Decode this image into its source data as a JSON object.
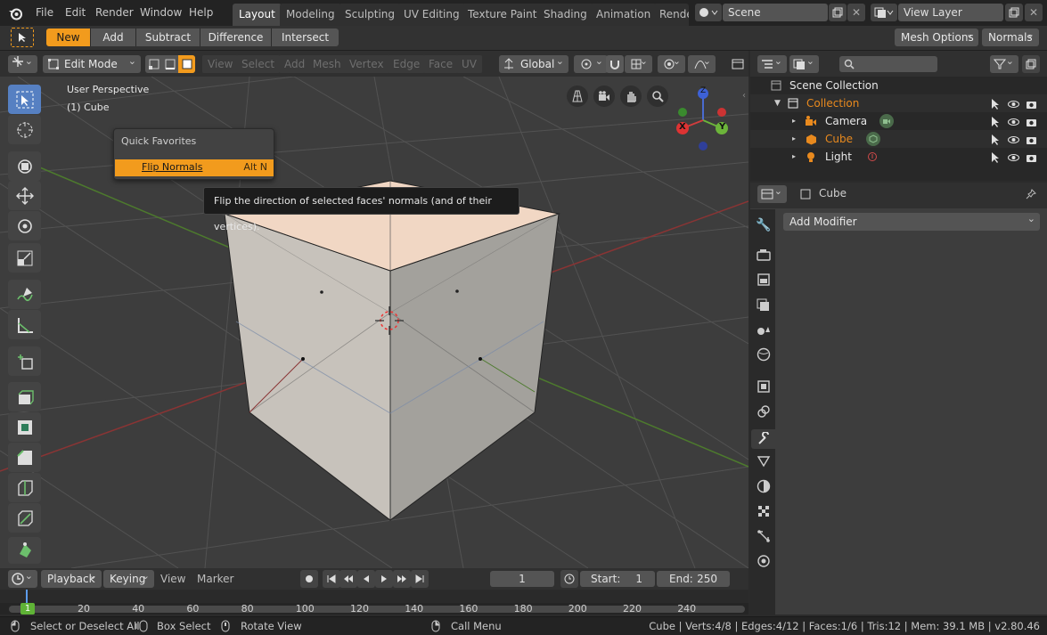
{
  "menu": [
    "File",
    "Edit",
    "Render",
    "Window",
    "Help"
  ],
  "workspaces": [
    "Layout",
    "Modeling",
    "Sculpting",
    "UV Editing",
    "Texture Paint",
    "Shading",
    "Animation",
    "Rende"
  ],
  "scene_name": "Scene",
  "view_layer": "View Layer",
  "boolean_ops": [
    "New",
    "Add",
    "Subtract",
    "Difference",
    "Intersect"
  ],
  "mesh_options_label": "Mesh Options",
  "normals_label": "Normals",
  "mode_label": "Edit Mode",
  "viewport_menus": [
    "View",
    "Select",
    "Add",
    "Mesh",
    "Vertex",
    "Edge",
    "Face",
    "UV"
  ],
  "transform_orientation": "Global",
  "viewport_info": {
    "perspective": "User Perspective",
    "object": "(1) Cube"
  },
  "quick_favorites": {
    "title": "Quick Favorites",
    "item_label": "Flip Normals",
    "item_shortcut": "Alt N"
  },
  "tooltip": "Flip the direction of selected faces' normals (and of their vertices).",
  "axis_labels": {
    "x": "X",
    "y": "Y",
    "z": "Z"
  },
  "outliner": {
    "root": "Scene Collection",
    "collection": "Collection",
    "items": [
      "Camera",
      "Cube",
      "Light"
    ]
  },
  "properties": {
    "object_name": "Cube",
    "add_modifier": "Add Modifier"
  },
  "timeline": {
    "playback": "Playback",
    "keying": "Keying",
    "view": "View",
    "marker": "Marker",
    "current_frame": "1",
    "start_label": "Start:",
    "start_value": "1",
    "end_label": "End:",
    "end_value": "250",
    "ticks": [
      "20",
      "40",
      "60",
      "80",
      "100",
      "120",
      "140",
      "160",
      "180",
      "200",
      "220",
      "240"
    ],
    "playhead_label": "1"
  },
  "status": {
    "select": "Select or Deselect All",
    "box": "Box Select",
    "rotate": "Rotate View",
    "call_menu": "Call Menu",
    "stats": "Cube | Verts:4/8 | Edges:4/12 | Faces:1/6 | Tris:12 | Mem: 39.1 MB | v2.80.46"
  },
  "colors": {
    "accent": "#f29b1d",
    "active_tool": "#5680c2",
    "selected_collection": "#e98a1e"
  }
}
